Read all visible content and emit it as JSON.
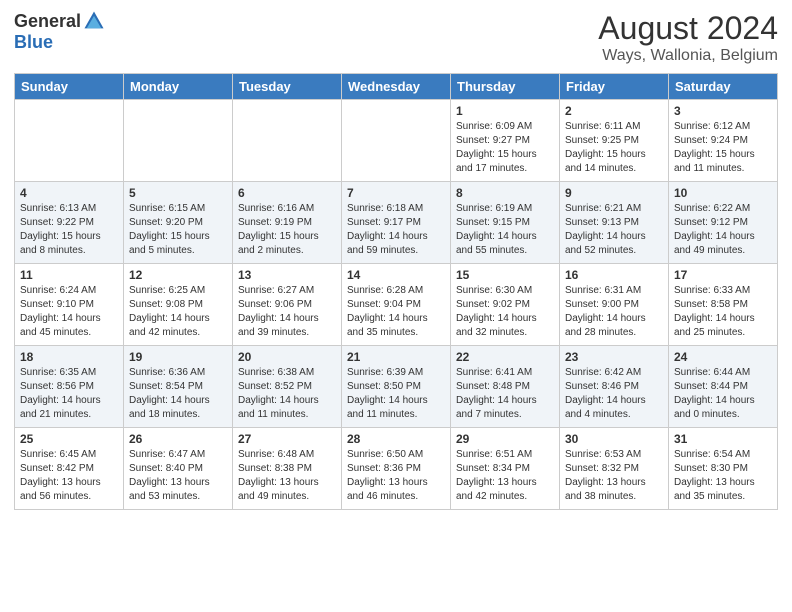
{
  "header": {
    "logo_general": "General",
    "logo_blue": "Blue",
    "main_title": "August 2024",
    "subtitle": "Ways, Wallonia, Belgium"
  },
  "days_of_week": [
    "Sunday",
    "Monday",
    "Tuesday",
    "Wednesday",
    "Thursday",
    "Friday",
    "Saturday"
  ],
  "weeks": [
    [
      {
        "day": "",
        "info": ""
      },
      {
        "day": "",
        "info": ""
      },
      {
        "day": "",
        "info": ""
      },
      {
        "day": "",
        "info": ""
      },
      {
        "day": "1",
        "info": "Sunrise: 6:09 AM\nSunset: 9:27 PM\nDaylight: 15 hours\nand 17 minutes."
      },
      {
        "day": "2",
        "info": "Sunrise: 6:11 AM\nSunset: 9:25 PM\nDaylight: 15 hours\nand 14 minutes."
      },
      {
        "day": "3",
        "info": "Sunrise: 6:12 AM\nSunset: 9:24 PM\nDaylight: 15 hours\nand 11 minutes."
      }
    ],
    [
      {
        "day": "4",
        "info": "Sunrise: 6:13 AM\nSunset: 9:22 PM\nDaylight: 15 hours\nand 8 minutes."
      },
      {
        "day": "5",
        "info": "Sunrise: 6:15 AM\nSunset: 9:20 PM\nDaylight: 15 hours\nand 5 minutes."
      },
      {
        "day": "6",
        "info": "Sunrise: 6:16 AM\nSunset: 9:19 PM\nDaylight: 15 hours\nand 2 minutes."
      },
      {
        "day": "7",
        "info": "Sunrise: 6:18 AM\nSunset: 9:17 PM\nDaylight: 14 hours\nand 59 minutes."
      },
      {
        "day": "8",
        "info": "Sunrise: 6:19 AM\nSunset: 9:15 PM\nDaylight: 14 hours\nand 55 minutes."
      },
      {
        "day": "9",
        "info": "Sunrise: 6:21 AM\nSunset: 9:13 PM\nDaylight: 14 hours\nand 52 minutes."
      },
      {
        "day": "10",
        "info": "Sunrise: 6:22 AM\nSunset: 9:12 PM\nDaylight: 14 hours\nand 49 minutes."
      }
    ],
    [
      {
        "day": "11",
        "info": "Sunrise: 6:24 AM\nSunset: 9:10 PM\nDaylight: 14 hours\nand 45 minutes."
      },
      {
        "day": "12",
        "info": "Sunrise: 6:25 AM\nSunset: 9:08 PM\nDaylight: 14 hours\nand 42 minutes."
      },
      {
        "day": "13",
        "info": "Sunrise: 6:27 AM\nSunset: 9:06 PM\nDaylight: 14 hours\nand 39 minutes."
      },
      {
        "day": "14",
        "info": "Sunrise: 6:28 AM\nSunset: 9:04 PM\nDaylight: 14 hours\nand 35 minutes."
      },
      {
        "day": "15",
        "info": "Sunrise: 6:30 AM\nSunset: 9:02 PM\nDaylight: 14 hours\nand 32 minutes."
      },
      {
        "day": "16",
        "info": "Sunrise: 6:31 AM\nSunset: 9:00 PM\nDaylight: 14 hours\nand 28 minutes."
      },
      {
        "day": "17",
        "info": "Sunrise: 6:33 AM\nSunset: 8:58 PM\nDaylight: 14 hours\nand 25 minutes."
      }
    ],
    [
      {
        "day": "18",
        "info": "Sunrise: 6:35 AM\nSunset: 8:56 PM\nDaylight: 14 hours\nand 21 minutes."
      },
      {
        "day": "19",
        "info": "Sunrise: 6:36 AM\nSunset: 8:54 PM\nDaylight: 14 hours\nand 18 minutes."
      },
      {
        "day": "20",
        "info": "Sunrise: 6:38 AM\nSunset: 8:52 PM\nDaylight: 14 hours\nand 11 minutes."
      },
      {
        "day": "21",
        "info": "Sunrise: 6:39 AM\nSunset: 8:50 PM\nDaylight: 14 hours\nand 11 minutes."
      },
      {
        "day": "22",
        "info": "Sunrise: 6:41 AM\nSunset: 8:48 PM\nDaylight: 14 hours\nand 7 minutes."
      },
      {
        "day": "23",
        "info": "Sunrise: 6:42 AM\nSunset: 8:46 PM\nDaylight: 14 hours\nand 4 minutes."
      },
      {
        "day": "24",
        "info": "Sunrise: 6:44 AM\nSunset: 8:44 PM\nDaylight: 14 hours\nand 0 minutes."
      }
    ],
    [
      {
        "day": "25",
        "info": "Sunrise: 6:45 AM\nSunset: 8:42 PM\nDaylight: 13 hours\nand 56 minutes."
      },
      {
        "day": "26",
        "info": "Sunrise: 6:47 AM\nSunset: 8:40 PM\nDaylight: 13 hours\nand 53 minutes."
      },
      {
        "day": "27",
        "info": "Sunrise: 6:48 AM\nSunset: 8:38 PM\nDaylight: 13 hours\nand 49 minutes."
      },
      {
        "day": "28",
        "info": "Sunrise: 6:50 AM\nSunset: 8:36 PM\nDaylight: 13 hours\nand 46 minutes."
      },
      {
        "day": "29",
        "info": "Sunrise: 6:51 AM\nSunset: 8:34 PM\nDaylight: 13 hours\nand 42 minutes."
      },
      {
        "day": "30",
        "info": "Sunrise: 6:53 AM\nSunset: 8:32 PM\nDaylight: 13 hours\nand 38 minutes."
      },
      {
        "day": "31",
        "info": "Sunrise: 6:54 AM\nSunset: 8:30 PM\nDaylight: 13 hours\nand 35 minutes."
      }
    ]
  ]
}
